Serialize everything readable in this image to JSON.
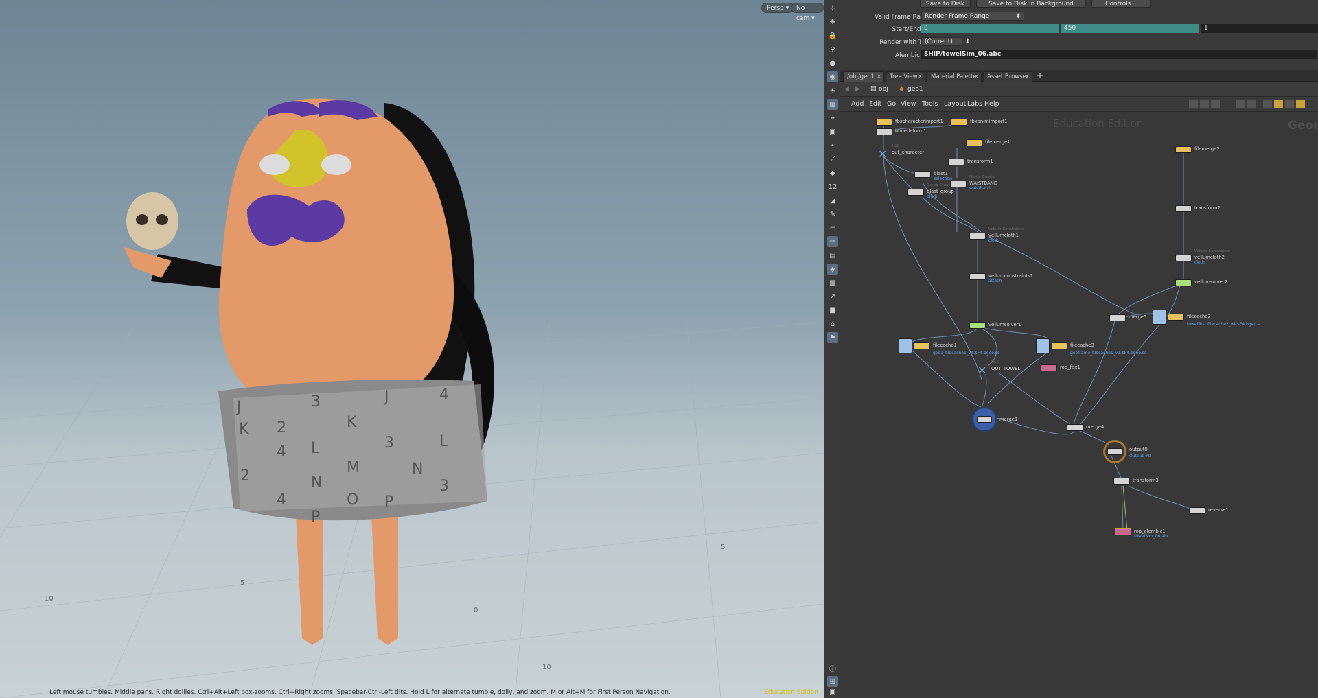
{
  "viewport": {
    "persp_label": "Persp ▾",
    "cam_label": "No cam ▾",
    "status": "Left mouse tumbles. Middle pans. Right dollies. Ctrl+Alt+Left box-zooms. Ctrl+Right zooms. Spacebar-Ctrl-Left tilts. Hold L for alternate tumble, dolly, and zoom. M or Alt+M for First Person Navigation.",
    "edition": "Education Edition",
    "towel_letters": [
      "J",
      "3",
      "J",
      "4",
      "K",
      "2",
      "K",
      "L",
      "3",
      "L",
      "4",
      "M",
      "N",
      "2",
      "N",
      "3",
      "O",
      "P",
      "4",
      "P"
    ],
    "grid_labels": [
      "10",
      "5",
      "0",
      "5",
      "10"
    ]
  },
  "params": {
    "save_disk": "Save to Disk",
    "save_bg": "Save to Disk in Background",
    "controls": "Controls...",
    "valid_frame_label": "Valid Frame Range",
    "valid_frame_value": "Render Frame Range",
    "start_label": "Start/End/Inc",
    "start": "0",
    "end": "450",
    "inc": "1",
    "take_label": "Render with Take",
    "take_value": "(Current)",
    "alembic_label": "Alembic File",
    "alembic_value": "$HIP/towelSim_06.abc"
  },
  "tabs": [
    {
      "label": "/obj/geo1",
      "active": true
    },
    {
      "label": "Tree View",
      "active": false
    },
    {
      "label": "Material Palette",
      "active": false
    },
    {
      "label": "Asset Browser",
      "active": false
    }
  ],
  "path": {
    "obj": "obj",
    "geo": "geo1"
  },
  "menu": [
    "Add",
    "Edit",
    "Go",
    "View",
    "Tools",
    "Layout",
    "Labs",
    "Help"
  ],
  "network": {
    "watermark": "Education Edition",
    "context": "Geom",
    "nodes": [
      {
        "id": "fbxcharacterimport1",
        "name": "fbxcharacterimport1",
        "color": "#e6c15c"
      },
      {
        "id": "fbxanimimport1",
        "name": "fbxanimimport1",
        "color": "#e6c15c"
      },
      {
        "id": "bonedeform1",
        "name": "bonedeform1",
        "color": "#d4d4d4"
      },
      {
        "id": "out_character",
        "name": "out_character",
        "dim": "Null",
        "color": "#6ea5d8"
      },
      {
        "id": "filemerge1",
        "name": "filemerge1",
        "color": "#e6c15c"
      },
      {
        "id": "transform1",
        "name": "transform1",
        "color": "#d4d4d4"
      },
      {
        "id": "blast1",
        "name": "blast1",
        "sub": "selection",
        "color": "#d4d4d4"
      },
      {
        "id": "blast_group",
        "name": "blast_group",
        "sub": "blurb",
        "dim": "Group Create",
        "color": "#d4d4d4"
      },
      {
        "id": "waistband",
        "name": "WAISTBAND",
        "sub": "waistband",
        "dim": "Group Create",
        "color": "#d4d4d4"
      },
      {
        "id": "vellumcloth1",
        "name": "vellumcloth1",
        "sub": "cloth",
        "dim": "Vellum Constraints",
        "color": "#d4d4d4"
      },
      {
        "id": "vellumconstraints1",
        "name": "vellumconstraints1",
        "sub": "attach",
        "color": "#d4d4d4"
      },
      {
        "id": "vellumsolver1",
        "name": "vellumsolver1",
        "color": "#a8e07a"
      },
      {
        "id": "filecache1",
        "name": "filecache1",
        "sub": "geo1_filecache1_v4.$F4.bgeo.sc",
        "color": "#e6c15c"
      },
      {
        "id": "filecache3",
        "name": "filecache3",
        "sub": "geoframe_filecache1_v1.$F4.bgeo.sc",
        "color": "#e6c15c"
      },
      {
        "id": "rop_fbx1",
        "name": "rop_fbx1",
        "color": "#c86a8c"
      },
      {
        "id": "out_towel",
        "name": "OUT_TOWEL",
        "dim": "Null",
        "color": "#6ea5d8"
      },
      {
        "id": "merge1",
        "name": "merge1",
        "color": "#d4d4d4"
      },
      {
        "id": "filemerge2",
        "name": "filemerge2",
        "color": "#e6c15c"
      },
      {
        "id": "transform2",
        "name": "transform2",
        "color": "#d4d4d4"
      },
      {
        "id": "vellumcloth2",
        "name": "vellumcloth2",
        "sub": "cloth",
        "dim": "Vellum Constraints",
        "color": "#d4d4d4"
      },
      {
        "id": "vellumsolver2",
        "name": "vellumsolver2",
        "color": "#a8e07a"
      },
      {
        "id": "merge5",
        "name": "merge5",
        "color": "#d4d4d4"
      },
      {
        "id": "filecache2",
        "name": "filecache2",
        "sub": "towelTest.filecache2_v4.$F4.bgeo.sc",
        "color": "#e6c15c"
      },
      {
        "id": "merge4",
        "name": "merge4",
        "color": "#d4d4d4"
      },
      {
        "id": "output0",
        "name": "output0",
        "sub": "Output #0",
        "color": "#d4d4d4"
      },
      {
        "id": "transform3",
        "name": "transform3",
        "color": "#d4d4d4"
      },
      {
        "id": "reverse1",
        "name": "reverse1",
        "color": "#d4d4d4"
      },
      {
        "id": "rop_alembic1",
        "name": "rop_alembic1",
        "sub": "towelSim_06.abc",
        "color": "#c86a8c"
      }
    ]
  }
}
